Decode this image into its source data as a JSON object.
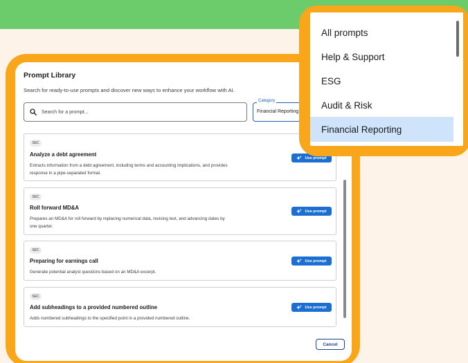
{
  "modal": {
    "title": "Prompt Library",
    "subtitle": "Search for ready-to-use prompts and discover new ways to enhance your workflow with AI.",
    "search_placeholder": "Search for a prompt...",
    "category_label": "Category",
    "category_value": "Financial Reporting",
    "use_prompt_label": "Use prompt",
    "cancel_label": "Cancel",
    "cards": [
      {
        "badge": "SEC",
        "title": "Analyze a debt agreement",
        "desc_line1": "Extracts information from a debt agreement, including terms and accounting implications, and provides",
        "desc_line2": "response in a pipe-separated format."
      },
      {
        "badge": "SEC",
        "title": "Roll forward MD&A",
        "desc_line1": "Prepares an MD&A for roll forward by replacing numerical data, revising text, and advancing dates by",
        "desc_line2": "one quarter."
      },
      {
        "badge": "SEC",
        "title": "Preparing for earnings call",
        "desc_line1": "Generate potential analyst questions based on an MD&A excerpt.",
        "desc_line2": ""
      },
      {
        "badge": "SEC",
        "title": "Add subheadings to a provided numbered outline",
        "desc_line1": "Adds numbered subheadings to the specified point in a provided numbered outline.",
        "desc_line2": ""
      }
    ]
  },
  "dropdown": {
    "items": [
      "All prompts",
      "Help & Support",
      "ESG",
      "Audit & Risk",
      "Financial Reporting"
    ],
    "selected": "Financial Reporting"
  },
  "colors": {
    "green_band": "#6ccb6a",
    "background": "#fdf3e8",
    "orange_frame": "#f9a61a",
    "primary_blue": "#1b6fd3",
    "selected_item": "#cfe4fb"
  },
  "icons": {
    "search": "search-icon",
    "sparkle": "sparkle-icon"
  }
}
